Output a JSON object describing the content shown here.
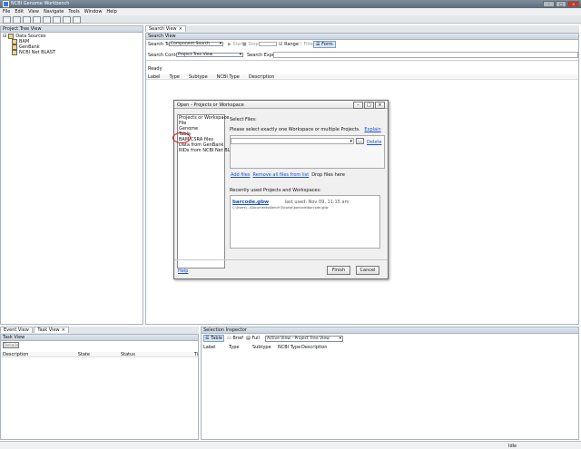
{
  "window": {
    "title": "NCBI Genome Workbench"
  },
  "menu": [
    "File",
    "Edit",
    "View",
    "Navigate",
    "Tools",
    "Window",
    "Help"
  ],
  "project_tree": {
    "title": "Project Tree View",
    "root": "Data Sources",
    "items": [
      "BAM",
      "GenBank",
      "NCBI Net BLAST"
    ]
  },
  "search_view": {
    "tab": "Search View",
    "header": "Search View",
    "tool_label": "Search Tool:",
    "tool_value": "Component Search",
    "start_label": "Start",
    "stop_label": "Stop",
    "range_label": "Range",
    "filter_label": "Filter",
    "form_label": "Form",
    "context_label": "Search Context:",
    "context_value": "Project Tree View",
    "expression_label": "Search Expression:",
    "status": "Ready",
    "columns": [
      "Label",
      "Type",
      "Subtype",
      "NCBI Type",
      "Description"
    ]
  },
  "dialog": {
    "title": "Open - Projects or Workspace",
    "options": [
      "Projects or Workspace",
      "File",
      "Genome",
      "Table",
      "BAM/CSRA files",
      "Data from GenBank",
      "RIDs from NCBI Net BLAST"
    ],
    "select_files_label": "Select Files:",
    "instruction": "Please select exactly one Workspace or multiple Projects.",
    "explain": "Explain",
    "browse": "...",
    "delete": "Delete",
    "add_files": "Add files",
    "remove_all": "Remove all files from list",
    "drop": "Drop files here",
    "recent_label": "Recently used Projects and Workspaces:",
    "recent_name": "barcode.gbw",
    "recent_last_used": "last used: Nov 09, 11:15 am",
    "recent_path": "C:\\Users\\...\\Documents\\Bench\\Tutorial\\barcode\\barcode.gbw",
    "help": "Help",
    "finish": "Finish",
    "cancel": "Cancel"
  },
  "bottom_left": {
    "tabs": [
      "Event View",
      "Task View"
    ],
    "header": "Task View",
    "details": "Details",
    "columns": [
      "Description",
      "State",
      "Status",
      "Ti"
    ]
  },
  "selection_inspector": {
    "header": "Selection Inspector",
    "view_table": "Table",
    "view_brief": "Brief",
    "view_full": "Full",
    "active_view": "Active View - Project Tree View",
    "columns": [
      "Label",
      "Type",
      "Subtype",
      "NCBI Type",
      "Description"
    ]
  },
  "statusbar": {
    "right": "Idle"
  }
}
